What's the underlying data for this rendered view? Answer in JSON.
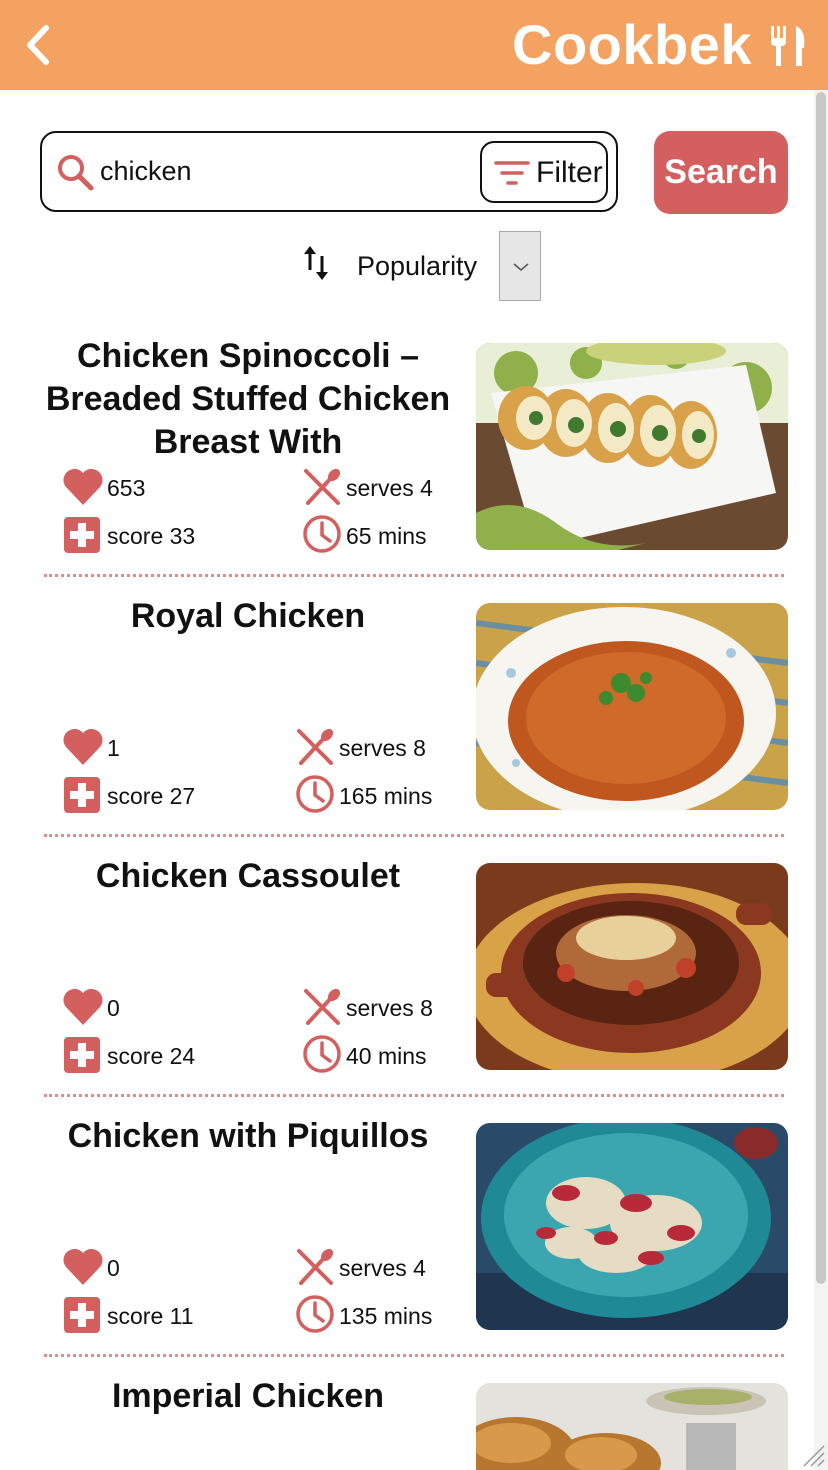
{
  "header": {
    "app_title": "Cookbek"
  },
  "search": {
    "query": "chicken",
    "filter_label": "Filter",
    "search_label": "Search"
  },
  "sort": {
    "label": "Popularity"
  },
  "theme": {
    "header_bg": "#f4a261",
    "accent": "#d35f5f",
    "divider": "#e58a8a"
  },
  "recipes": [
    {
      "title": "Chicken Spinoccoli – Breaded Stuffed Chicken Breast With",
      "likes": "653",
      "serves": "serves 4",
      "score": "score 33",
      "time": "65 mins"
    },
    {
      "title": "Royal Chicken",
      "likes": "1",
      "serves": "serves 8",
      "score": "score 27",
      "time": "165 mins"
    },
    {
      "title": "Chicken Cassoulet",
      "likes": "0",
      "serves": "serves 8",
      "score": "score 24",
      "time": "40 mins"
    },
    {
      "title": "Chicken with Piquillos",
      "likes": "0",
      "serves": "serves 4",
      "score": "score 11",
      "time": "135 mins"
    },
    {
      "title": "Imperial Chicken",
      "likes": "",
      "serves": "",
      "score": "",
      "time": ""
    }
  ]
}
